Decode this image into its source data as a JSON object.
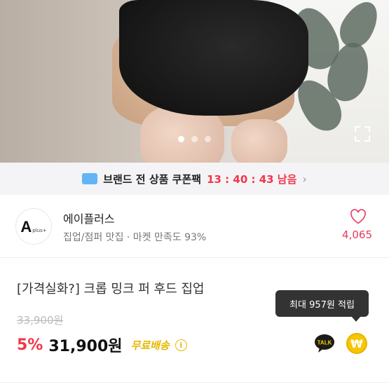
{
  "coupon_bar": {
    "text": "브랜드 전 상품 쿠폰팩",
    "timer": "13 : 40 : 43 남음",
    "chevron": "›"
  },
  "seller": {
    "logo_letter": "A",
    "logo_suffix": "plus+",
    "name": "에이플러스",
    "meta": "집업/점퍼 맛집 · 마켓 만족도 93%",
    "likes": "4,065"
  },
  "product": {
    "title": "[가격실화?] 크롭 밍크 퍼  후드 집업",
    "original_price": "33,900원",
    "discount": "5%",
    "price": "31,900원",
    "shipping": "무료배송",
    "info_glyph": "i"
  },
  "reward_tooltip": "최대 957원 적립",
  "actions": {
    "talk_label": "TALK",
    "points_glyph": "₩"
  },
  "carousel": {
    "count": 3,
    "active": 0
  },
  "colors": {
    "accent_red": "#f2364a",
    "shipping_yellow": "#e6b800",
    "timer_red": "#f2364a"
  }
}
